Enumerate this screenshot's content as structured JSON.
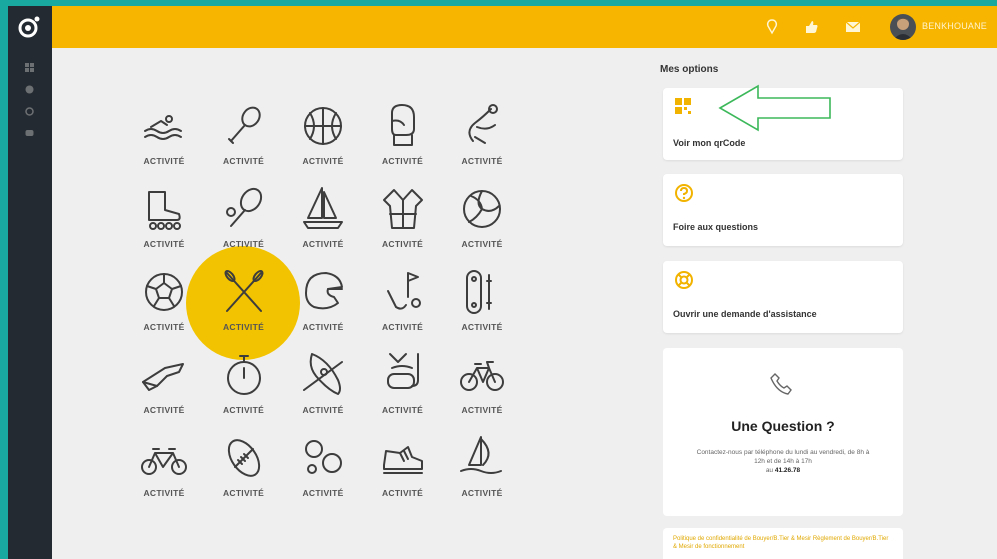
{
  "topbar": {
    "username": "BENKHOUANE",
    "icons": [
      "location-pin-icon",
      "thumbs-up-icon",
      "mail-icon"
    ],
    "accent_color": "#f7b500"
  },
  "sidebar": {
    "logo": "app-logo-icon",
    "items": [
      "grid-icon",
      "globe-icon",
      "location-icon",
      "chat-icon"
    ],
    "color": "#232a31"
  },
  "activities": {
    "label": "ACTIVITÉ",
    "highlight_color": "#f2c300",
    "items": [
      {
        "icon": "swimming-icon"
      },
      {
        "icon": "badminton-icon"
      },
      {
        "icon": "basketball-icon"
      },
      {
        "icon": "boxing-glove-icon"
      },
      {
        "icon": "climbing-icon"
      },
      {
        "icon": "roller-skate-icon"
      },
      {
        "icon": "tennis-icon"
      },
      {
        "icon": "sailing-icon"
      },
      {
        "icon": "judo-icon"
      },
      {
        "icon": "volleyball-icon"
      },
      {
        "icon": "soccer-ball-icon"
      },
      {
        "icon": "canoe-paddles-icon",
        "highlighted": true
      },
      {
        "icon": "motocross-helmet-icon"
      },
      {
        "icon": "golf-icon"
      },
      {
        "icon": "skateboard-icon"
      },
      {
        "icon": "shooting-icon"
      },
      {
        "icon": "stopwatch-icon"
      },
      {
        "icon": "kayak-icon"
      },
      {
        "icon": "diving-icon"
      },
      {
        "icon": "bicycle-icon"
      },
      {
        "icon": "tandem-bike-icon"
      },
      {
        "icon": "rugby-ball-icon"
      },
      {
        "icon": "petanque-icon"
      },
      {
        "icon": "sneaker-icon"
      },
      {
        "icon": "windsurf-icon"
      }
    ]
  },
  "options": {
    "title": "Mes options",
    "cards": [
      {
        "label": "Voir mon qrCode",
        "icon": "qrcode-icon"
      },
      {
        "label": "Foire aux questions",
        "icon": "question-icon"
      },
      {
        "label": "Ouvrir une demande d'assistance",
        "icon": "assistance-icon"
      }
    ],
    "arrow_color": "#3cb85a"
  },
  "question": {
    "title": "Une Question ?",
    "text": "Contactez-nous par téléphone du lundi au vendredi, de 8h à 12h et de 14h à 17h",
    "phone_prefix": "au",
    "phone": "41.26.78"
  },
  "policy": {
    "text": "Politique de confidentialité de Bouyer/B.Tier & Mesir Règlement de Bouyer/B.Tier & Mesir de fonctionnement"
  }
}
